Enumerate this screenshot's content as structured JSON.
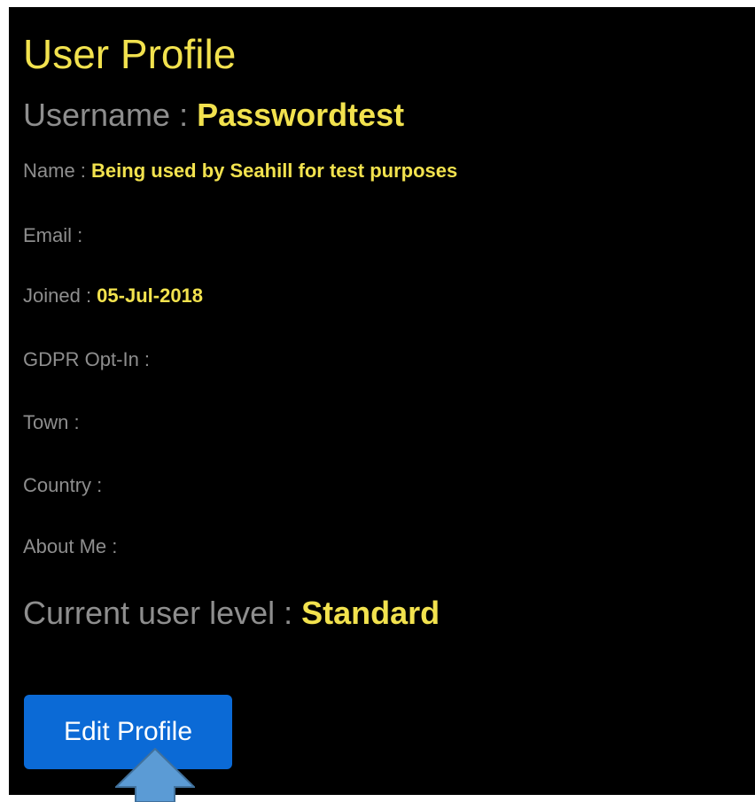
{
  "profile": {
    "title": "User Profile",
    "username_label": "Username : ",
    "username_value": "Passwordtest",
    "fields": {
      "name_label": "Name : ",
      "name_value": "Being used by Seahill for test purposes",
      "email_label": "Email : ",
      "email_value": "",
      "joined_label": "Joined : ",
      "joined_value": "05-Jul-2018",
      "gdpr_label": "GDPR Opt-In : ",
      "gdpr_value": "",
      "town_label": "Town : ",
      "town_value": "",
      "country_label": "Country : ",
      "country_value": "",
      "about_label": "About Me : ",
      "about_value": ""
    },
    "level_label": "Current user level : ",
    "level_value": "Standard",
    "edit_button_label": "Edit Profile"
  },
  "colors": {
    "background": "#000000",
    "label": "#8e8e8e",
    "value": "#f2e24e",
    "button": "#0b6ad6",
    "pointer_arrow": "#5b9bd5"
  },
  "icons": {
    "pointer": "up-arrow-icon"
  }
}
